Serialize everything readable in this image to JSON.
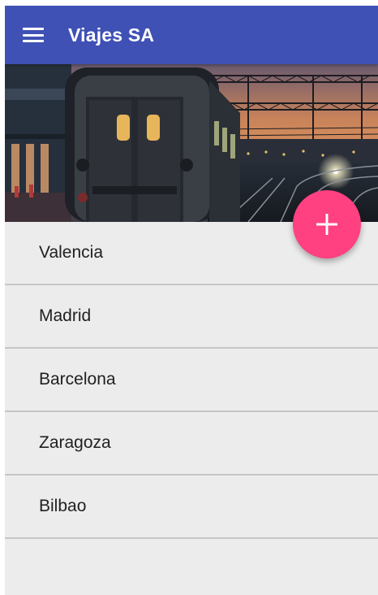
{
  "app_bar": {
    "title": "Viajes SA",
    "menu_icon": "hamburger-menu-icon",
    "background_color": "#3f51b5"
  },
  "header_image": {
    "subject": "train-station-dusk-image"
  },
  "fab": {
    "icon": "plus-icon",
    "color": "#ff4081"
  },
  "cities": [
    {
      "label": "Valencia"
    },
    {
      "label": "Madrid"
    },
    {
      "label": "Barcelona"
    },
    {
      "label": "Zaragoza"
    },
    {
      "label": "Bilbao"
    }
  ]
}
